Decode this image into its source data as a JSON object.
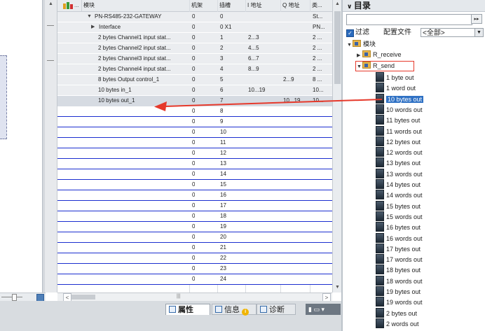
{
  "table": {
    "headers": {
      "device_icon_dots": "...",
      "module": "模块",
      "rack": "机架",
      "slot": "插槽",
      "i_addr": "I 地址",
      "q_addr": "Q 地址",
      "type": "类..."
    },
    "device": {
      "name": "PN-RS485-232-GATEWAY",
      "rack": "0",
      "slot": "0",
      "type": "St..."
    },
    "interface": {
      "name": "Interface",
      "rack": "0",
      "slot": "0 X1",
      "type": "PN..."
    },
    "rows": [
      {
        "name": "2 bytes Channel1 input stat...",
        "rack": "0",
        "slot": "1",
        "i": "2...3",
        "q": "",
        "type": "2 ..."
      },
      {
        "name": "2 bytes Channel2 input stat...",
        "rack": "0",
        "slot": "2",
        "i": "4...5",
        "q": "",
        "type": "2 ..."
      },
      {
        "name": "2 bytes Channel3 input stat...",
        "rack": "0",
        "slot": "3",
        "i": "6...7",
        "q": "",
        "type": "2 ..."
      },
      {
        "name": "2 bytes Channel4 input stat...",
        "rack": "0",
        "slot": "4",
        "i": "8...9",
        "q": "",
        "type": "2 ..."
      },
      {
        "name": "8 bytes Output control_1",
        "rack": "0",
        "slot": "5",
        "i": "",
        "q": "2...9",
        "type": "8 ..."
      },
      {
        "name": "10 bytes in_1",
        "rack": "0",
        "slot": "6",
        "i": "10...19",
        "q": "",
        "type": "10..."
      },
      {
        "name": "10 bytes out_1",
        "rack": "0",
        "slot": "7",
        "i": "",
        "q": "10...19",
        "type": "10..."
      }
    ],
    "empty_slots": [
      {
        "rack": "0",
        "slot": "8"
      },
      {
        "rack": "0",
        "slot": "9"
      },
      {
        "rack": "0",
        "slot": "10"
      },
      {
        "rack": "0",
        "slot": "11"
      },
      {
        "rack": "0",
        "slot": "12"
      },
      {
        "rack": "0",
        "slot": "13"
      },
      {
        "rack": "0",
        "slot": "14"
      },
      {
        "rack": "0",
        "slot": "15"
      },
      {
        "rack": "0",
        "slot": "16"
      },
      {
        "rack": "0",
        "slot": "17"
      },
      {
        "rack": "0",
        "slot": "18"
      },
      {
        "rack": "0",
        "slot": "19"
      },
      {
        "rack": "0",
        "slot": "20"
      },
      {
        "rack": "0",
        "slot": "21"
      },
      {
        "rack": "0",
        "slot": "22"
      },
      {
        "rack": "0",
        "slot": "23"
      },
      {
        "rack": "0",
        "slot": "24"
      }
    ]
  },
  "bottom_tabs": {
    "properties": "属性",
    "info": "信息",
    "diagnostics": "诊断"
  },
  "catalog": {
    "title": "目录",
    "filter_label": "过滤",
    "profile_label": "配置文件",
    "profile_value": "<全部>",
    "tree": {
      "root": "模块",
      "receive": "R_receive",
      "send": "R_send"
    },
    "items": [
      {
        "label": "1 byte out",
        "selected": false
      },
      {
        "label": "1 word out",
        "selected": false
      },
      {
        "label": "10 bytes out",
        "selected": true
      },
      {
        "label": "10 words out",
        "selected": false
      },
      {
        "label": "11 bytes out",
        "selected": false
      },
      {
        "label": "11 words out",
        "selected": false
      },
      {
        "label": "12 bytes out",
        "selected": false
      },
      {
        "label": "12 words out",
        "selected": false
      },
      {
        "label": "13 bytes out",
        "selected": false
      },
      {
        "label": "13 words out",
        "selected": false
      },
      {
        "label": "14 bytes out",
        "selected": false
      },
      {
        "label": "14 words out",
        "selected": false
      },
      {
        "label": "15 bytes out",
        "selected": false
      },
      {
        "label": "15 words out",
        "selected": false
      },
      {
        "label": "16 bytes out",
        "selected": false
      },
      {
        "label": "16 words out",
        "selected": false
      },
      {
        "label": "17 bytes out",
        "selected": false
      },
      {
        "label": "17 words out",
        "selected": false
      },
      {
        "label": "18 bytes out",
        "selected": false
      },
      {
        "label": "18 words out",
        "selected": false
      },
      {
        "label": "19 bytes out",
        "selected": false
      },
      {
        "label": "19 words out",
        "selected": false
      },
      {
        "label": "2 bytes out",
        "selected": false
      },
      {
        "label": "2 words out",
        "selected": false
      }
    ]
  },
  "colors": {
    "annotation_red": "#e6392b",
    "selection_blue": "#2f71c4",
    "empty_row_line": "#1b2ed0"
  }
}
